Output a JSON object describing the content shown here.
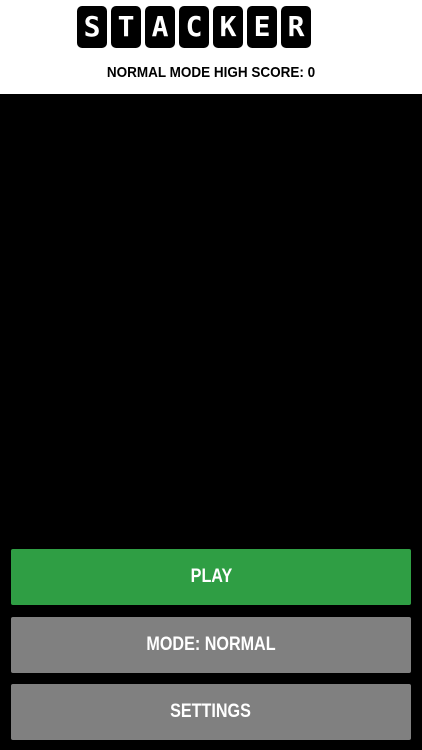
{
  "header": {
    "logo_letters": [
      "S",
      "T",
      "A",
      "C",
      "K",
      "E",
      "R"
    ],
    "high_score_label": "NORMAL MODE HIGH SCORE: 0"
  },
  "menu": {
    "play_label": "PLAY",
    "mode_label": "MODE: NORMAL",
    "settings_label": "SETTINGS"
  },
  "colors": {
    "header_bg": "#ffffff",
    "game_bg": "#000000",
    "play_button": "#2f9e44",
    "secondary_button": "#808080"
  }
}
